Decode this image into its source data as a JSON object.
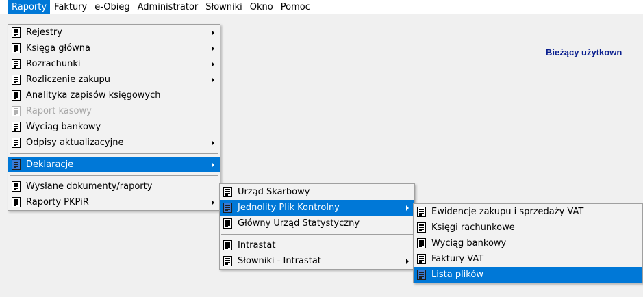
{
  "menubar": {
    "items": [
      "Raporty",
      "Faktury",
      "e-Obieg",
      "Administrator",
      "Słowniki",
      "Okno",
      "Pomoc"
    ]
  },
  "user_label": "Bieżący użytkown",
  "menu_raporty": {
    "items": [
      {
        "label": "Rejestry"
      },
      {
        "label": "Księga główna"
      },
      {
        "label": "Rozrachunki"
      },
      {
        "label": "Rozliczenie zakupu"
      },
      {
        "label": "Analityka zapisów księgowych"
      },
      {
        "label": "Raport kasowy"
      },
      {
        "label": "Wyciąg bankowy"
      },
      {
        "label": "Odpisy aktualizacyjne"
      },
      {
        "label": "Deklaracje"
      },
      {
        "label": "Wysłane dokumenty/raporty"
      },
      {
        "label": "Raporty PKPiR"
      }
    ]
  },
  "menu_deklaracje": {
    "items": [
      {
        "label": "Urząd Skarbowy"
      },
      {
        "label": "Jednolity Plik Kontrolny"
      },
      {
        "label": "Główny Urząd Statystyczny"
      },
      {
        "label": "Intrastat"
      },
      {
        "label": "Słowniki - Intrastat"
      }
    ]
  },
  "menu_jpk": {
    "items": [
      {
        "label": "Ewidencje zakupu i sprzedaży VAT"
      },
      {
        "label": "Księgi rachunkowe"
      },
      {
        "label": "Wyciąg bankowy"
      },
      {
        "label": "Faktury VAT"
      },
      {
        "label": "Lista plików"
      }
    ]
  },
  "colors": {
    "highlight": "#0078d7",
    "user_label": "#0a1f8f"
  }
}
